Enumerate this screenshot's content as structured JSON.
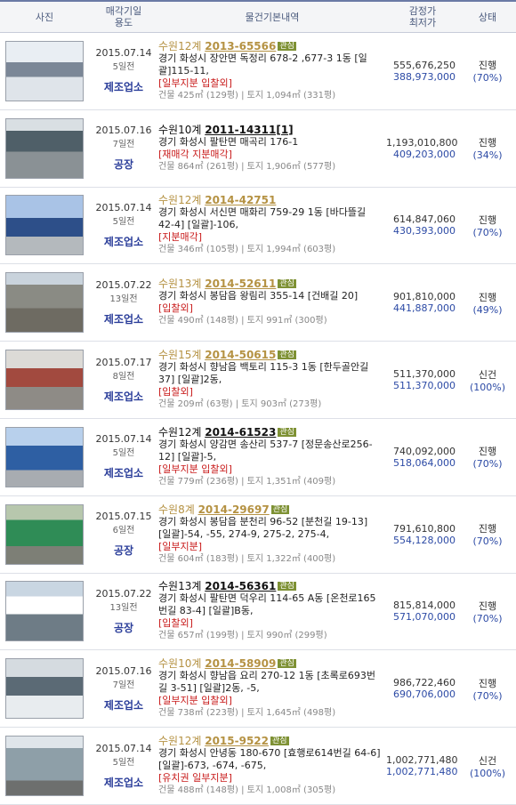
{
  "header": {
    "photo": "사진",
    "sale_date_1": "매각기일",
    "sale_date_2": "용도",
    "info": "물건기본내역",
    "price_1": "감정가",
    "price_2": "최저가",
    "status": "상태"
  },
  "rows": [
    {
      "date": "2015.07.14",
      "days": "5일전",
      "usage": "제조업소",
      "court": "수원12계 ",
      "case_no": "2013-65566",
      "tag": "관심",
      "visited": true,
      "addr": "경기 화성시 장안면 독정리 678-2 ,677-3 1동 [일괄]115-11,",
      "note": "[일부지분 입찰외]",
      "size": "건물 425㎡ (129평) | 토지 1,094㎡ (331평)",
      "appraisal": "555,676,250",
      "minimum": "388,973,000",
      "status": "진행",
      "pct": "(70%)"
    },
    {
      "date": "2015.07.16",
      "days": "7일전",
      "usage": "공장",
      "court": "수원10계 ",
      "case_no": "2011-14311[1]",
      "tag": "",
      "visited": false,
      "addr": "경기 화성시 팔탄면 매곡리 176-1",
      "note": "[재매각  지분매각]",
      "size": "건물 864㎡ (261평) | 토지 1,906㎡ (577평)",
      "appraisal": "1,193,010,800",
      "minimum": "409,203,000",
      "status": "진행",
      "pct": "(34%)"
    },
    {
      "date": "2015.07.14",
      "days": "5일전",
      "usage": "제조업소",
      "court": "수원12계 ",
      "case_no": "2014-42751",
      "tag": "",
      "visited": true,
      "addr": "경기 화성시 서신면 매화리 759-29 1동 [바다뜰길 42-4] [일괄]-106,",
      "note": "[지분매각]",
      "size": "건물 346㎡ (105평) | 토지 1,994㎡ (603평)",
      "appraisal": "614,847,060",
      "minimum": "430,393,000",
      "status": "진행",
      "pct": "(70%)"
    },
    {
      "date": "2015.07.22",
      "days": "13일전",
      "usage": "제조업소",
      "court": "수원13계 ",
      "case_no": "2014-52611",
      "tag": "관심",
      "visited": true,
      "addr": "경기 화성시 봉담읍 왕림리 355-14 [건배길 20]",
      "note": "[입찰외]",
      "size": "건물 490㎡ (148평) | 토지 991㎡ (300평)",
      "appraisal": "901,810,000",
      "minimum": "441,887,000",
      "status": "진행",
      "pct": "(49%)"
    },
    {
      "date": "2015.07.17",
      "days": "8일전",
      "usage": "제조업소",
      "court": "수원15계 ",
      "case_no": "2014-50615",
      "tag": "관심",
      "visited": true,
      "addr": "경기 화성시 향남읍 백토리 115-3 1동 [한두골안길 37] [일괄]2동,",
      "note": "[입찰외]",
      "size": "건물 209㎡ (63평) | 토지 903㎡ (273평)",
      "appraisal": "511,370,000",
      "minimum": "511,370,000",
      "status": "신건",
      "pct": "(100%)"
    },
    {
      "date": "2015.07.14",
      "days": "5일전",
      "usage": "제조업소",
      "court": "수원12계 ",
      "case_no": "2014-61523",
      "tag": "관심",
      "visited": false,
      "addr": "경기 화성시 양감면 송산리 537-7 [정문송산로256-12] [일괄]-5,",
      "note": "[일부지분 입찰외]",
      "size": "건물 779㎡ (236평) | 토지 1,351㎡ (409평)",
      "appraisal": "740,092,000",
      "minimum": "518,064,000",
      "status": "진행",
      "pct": "(70%)"
    },
    {
      "date": "2015.07.15",
      "days": "6일전",
      "usage": "공장",
      "court": "수원8계 ",
      "case_no": "2014-29697",
      "tag": "관심",
      "visited": true,
      "addr": "경기 화성시 봉담읍 분천리 96-52 [분천길 19-13] [일괄]-54, -55, 274-9, 275-2, 275-4,",
      "note": "[일부지분]",
      "size": "건물 604㎡ (183평) | 토지 1,322㎡ (400평)",
      "appraisal": "791,610,800",
      "minimum": "554,128,000",
      "status": "진행",
      "pct": "(70%)"
    },
    {
      "date": "2015.07.22",
      "days": "13일전",
      "usage": "공장",
      "court": "수원13계 ",
      "case_no": "2014-56361",
      "tag": "관심",
      "visited": false,
      "addr": "경기 화성시 팔탄면 덕우리 114-65 A동 [온천로165번길 83-4] [일괄]B동,",
      "note": "[입찰외]",
      "size": "건물 657㎡ (199평) | 토지 990㎡ (299평)",
      "appraisal": "815,814,000",
      "minimum": "571,070,000",
      "status": "진행",
      "pct": "(70%)"
    },
    {
      "date": "2015.07.16",
      "days": "7일전",
      "usage": "제조업소",
      "court": "수원10계 ",
      "case_no": "2014-58909",
      "tag": "관심",
      "visited": true,
      "addr": "경기 화성시 향남읍 요리 270-12 1동 [초록로693번길 3-51] [일괄]2동, -5,",
      "note": "[일부지분 입찰외]",
      "size": "건물 738㎡ (223평) | 토지 1,645㎡ (498평)",
      "appraisal": "986,722,460",
      "minimum": "690,706,000",
      "status": "진행",
      "pct": "(70%)"
    },
    {
      "date": "2015.07.14",
      "days": "5일전",
      "usage": "제조업소",
      "court": "수원12계 ",
      "case_no": "2015-9522",
      "tag": "관심",
      "visited": true,
      "addr": "경기 화성시 안녕동 180-670 [효행로614번길 64-6] [일괄]-673, -674, -675,",
      "note": "[유치권  일부지분]",
      "size": "건물 488㎡ (148평) | 토지 1,008㎡ (305평)",
      "appraisal": "1,002,771,480",
      "minimum": "1,002,771,480",
      "status": "신건",
      "pct": "(100%)"
    }
  ]
}
